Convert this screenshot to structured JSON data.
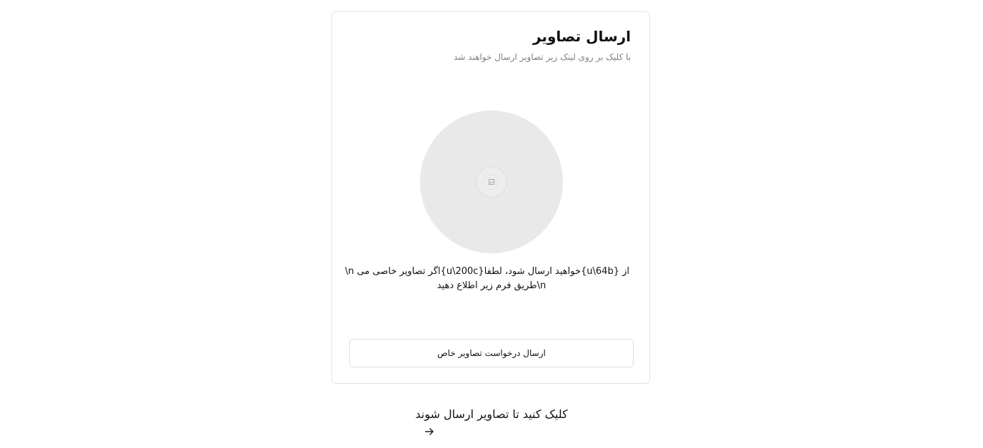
{
  "card": {
    "title": "ارسال تصاویر",
    "subtitle": "با کلیک بر روی لینک زیر تصاویر ارسال خواهند شد",
    "preview_icon": "image-icon",
    "description_line1": "از {u\\64b}خواهید ارسال شود، لطفا{u\\200c}اگر تصاویر خاصی می n\\",
    "description_line2": "n\\طریق فرم زیر اطلاع دهید",
    "request_button_label": "ارسال درخواست تصاویر خاص"
  },
  "cta": {
    "label": "کلیک کنید تا تصاویر  ارسال شوند",
    "icon": "arrow-right-icon"
  },
  "colors": {
    "card_border": "#e3e3e3",
    "circle_bg": "#e9e9e9",
    "subtitle_text": "#808080",
    "text": "#111111"
  }
}
